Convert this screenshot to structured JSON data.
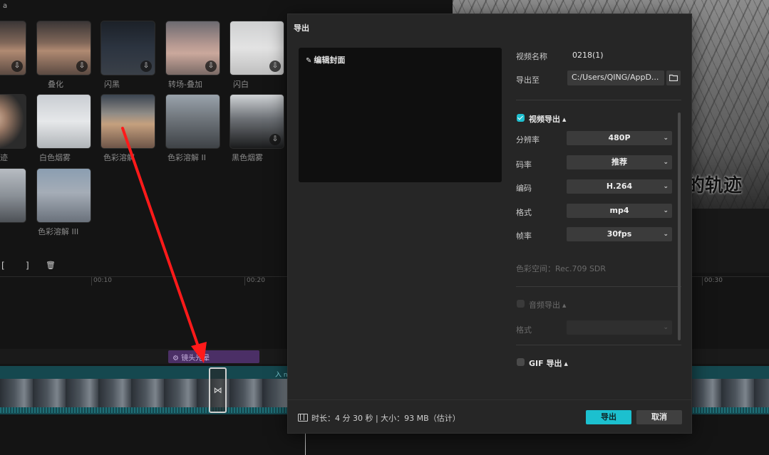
{
  "background": {
    "top_label": "а",
    "effects": [
      {
        "label": "",
        "style": "t-sunset"
      },
      {
        "label": "叠化",
        "style": "t-sunset"
      },
      {
        "label": "闪黑",
        "style": "t-dark"
      },
      {
        "label": "转场-叠加",
        "style": "t-pink"
      },
      {
        "label": "闪白",
        "style": "t-white"
      },
      {
        "label": "痕迹",
        "style": "t-face"
      },
      {
        "label": "白色烟雾",
        "style": "t-fog"
      },
      {
        "label": "色彩溶解",
        "style": "t-beach"
      },
      {
        "label": "色彩溶解 II",
        "style": "t-rock"
      },
      {
        "label": "黑色烟雾",
        "style": "t-black"
      },
      {
        "label": "",
        "style": "t-gray"
      },
      {
        "label": "色彩溶解 III",
        "style": "t-blue"
      }
    ],
    "download_glyph": "⇩",
    "tools": [
      "[",
      "]",
      "🗑"
    ],
    "ruler_ticks": [
      "00:10",
      "00:20",
      "00:30"
    ],
    "effect_clip_label": "⚙ 镜头光晕",
    "track_label": "入 n",
    "transition_glyph": "⋈",
    "preview_caption": "的轨迹"
  },
  "dialog": {
    "title": "导出",
    "cover_edit": "编辑封面",
    "video_name_label": "视频名称",
    "video_name_value": "0218(1)",
    "export_to_label": "导出至",
    "export_path": "C:/Users/QING/AppD...",
    "video_export": {
      "title": "视频导出",
      "checked": true,
      "settings": [
        {
          "label": "分辨率",
          "value": "480P"
        },
        {
          "label": "码率",
          "value": "推荐"
        },
        {
          "label": "编码",
          "value": "H.264"
        },
        {
          "label": "格式",
          "value": "mp4"
        },
        {
          "label": "帧率",
          "value": "30fps"
        }
      ],
      "color_space": "色彩空间：Rec.709 SDR"
    },
    "audio_export": {
      "title": "音频导出",
      "checked": false,
      "format_label": "格式",
      "format_value": ""
    },
    "gif_export": {
      "title": "GIF 导出",
      "checked": false
    },
    "footer_info": "时长：4 分 30 秒 | 大小：93 MB（估计）",
    "export_button": "导出",
    "cancel_button": "取消"
  },
  "colors": {
    "accent": "#1cc0cf",
    "arrow": "#ff1a1a"
  }
}
